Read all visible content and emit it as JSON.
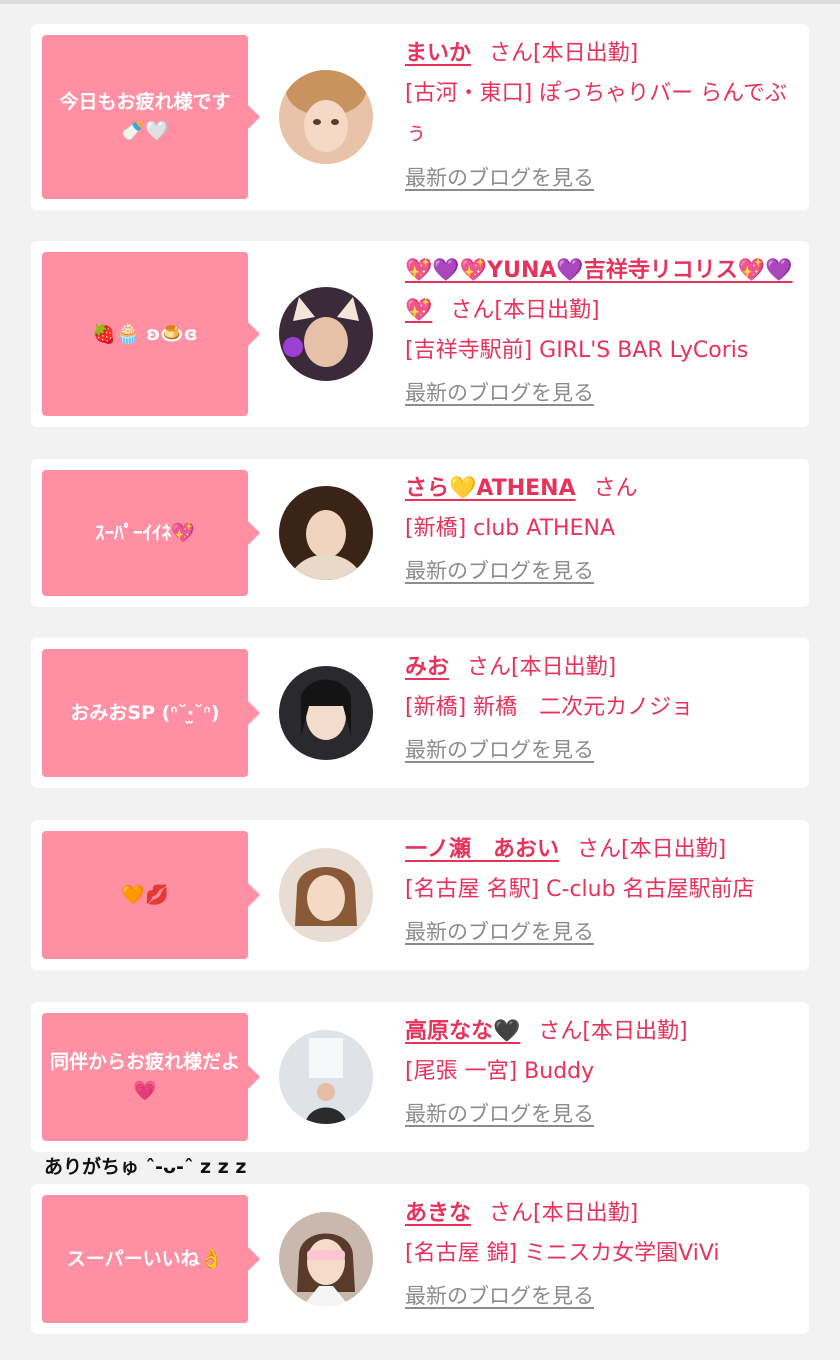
{
  "colors": {
    "bubble": "#ff8fa3",
    "accent": "#e8325b",
    "link_gray": "#8c8c8c"
  },
  "cards": [
    {
      "message": "今日もお疲れ様です🍼🤍",
      "name": "まいか",
      "san": "さん",
      "status": "[本日出勤]",
      "shop": "[古河・東口] ぽっちゃりバー らんでぶぅ",
      "blog": "最新のブログを見る"
    },
    {
      "message": "🍓🧁 ʚ🍮ɞ",
      "name": "💖💜💖YUNA💜吉祥寺リコリス💖💜💖",
      "san": "さん",
      "status": "[本日出勤]",
      "shop": "[吉祥寺駅前] GIRL'S BAR LyCoris",
      "blog": "最新のブログを見る"
    },
    {
      "message": "ｽｰﾊﾟｰｲｲﾈ💖",
      "name": "さら💛ATHENA",
      "san": "さん",
      "status": "",
      "shop": "[新橋] club ATHENA",
      "blog": "最新のブログを見る"
    },
    {
      "message": "おみおSP (ᐢ˘‧̫˘ᐢ)",
      "name": "みお",
      "san": "さん",
      "status": "[本日出勤]",
      "shop": "[新橋] 新橋　二次元カノジョ",
      "blog": "最新のブログを見る"
    },
    {
      "message": "🧡💋",
      "name": "一ノ瀬　あおい",
      "san": "さん",
      "status": "[本日出勤]",
      "shop": "[名古屋 名駅] C-club 名古屋駅前店",
      "blog": "最新のブログを見る"
    },
    {
      "message": "同伴からお疲れ様だよ💗",
      "name": "高原なな🖤",
      "san": "さん",
      "status": "[本日出勤]",
      "shop": "[尾張 一宮] Buddy",
      "blog": "最新のブログを見る"
    },
    {
      "message": "スーパーいいね👌",
      "name": "あきな",
      "san": "さん",
      "status": "[本日出勤]",
      "shop": "[名古屋 錦] ミニスカ女学園ViVi",
      "blog": "最新のブログを見る"
    }
  ],
  "handwritten_note": "ありがちゅ ˆ‐ᴗ‐ˆ z z z"
}
